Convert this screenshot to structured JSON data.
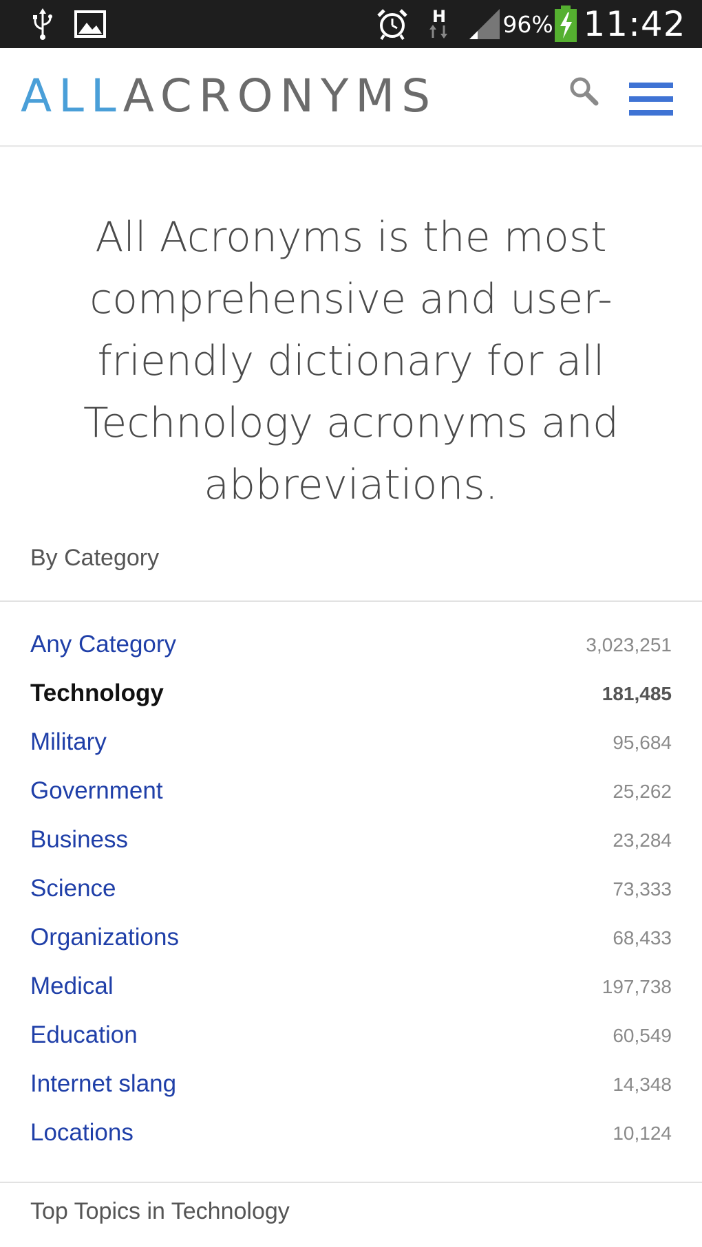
{
  "status_bar": {
    "battery_percent": "96%",
    "time": "11:42",
    "network_letter": "H",
    "icons": [
      "usb-icon",
      "image-icon",
      "alarm-icon",
      "network-h-icon",
      "signal-icon",
      "battery-charging-icon"
    ]
  },
  "header": {
    "logo_part1": "ALL",
    "logo_part2": "ACRONYMS",
    "logo_colors": {
      "part1": "#4a9fd8",
      "part2": "#6b6b6b"
    },
    "search_icon": "search-icon",
    "menu_icon": "hamburger-menu-icon",
    "menu_color": "#3f73d4"
  },
  "hero": {
    "text": "All Acronyms is the most comprehensive and user-friendly dictionary for all Technology acronyms and abbreviations."
  },
  "by_category": {
    "title": "By Category",
    "items": [
      {
        "name": "Any Category",
        "count": "3,023,251",
        "active": false
      },
      {
        "name": "Technology",
        "count": "181,485",
        "active": true
      },
      {
        "name": "Military",
        "count": "95,684",
        "active": false
      },
      {
        "name": "Government",
        "count": "25,262",
        "active": false
      },
      {
        "name": "Business",
        "count": "23,284",
        "active": false
      },
      {
        "name": "Science",
        "count": "73,333",
        "active": false
      },
      {
        "name": "Organizations",
        "count": "68,433",
        "active": false
      },
      {
        "name": "Medical",
        "count": "197,738",
        "active": false
      },
      {
        "name": "Education",
        "count": "60,549",
        "active": false
      },
      {
        "name": "Internet slang",
        "count": "14,348",
        "active": false
      },
      {
        "name": "Locations",
        "count": "10,124",
        "active": false
      }
    ]
  },
  "top_topics": {
    "title": "Top Topics in Technology"
  },
  "colors": {
    "link": "#1f3fa8",
    "active": "#111111",
    "count": "#8a8a8a"
  }
}
